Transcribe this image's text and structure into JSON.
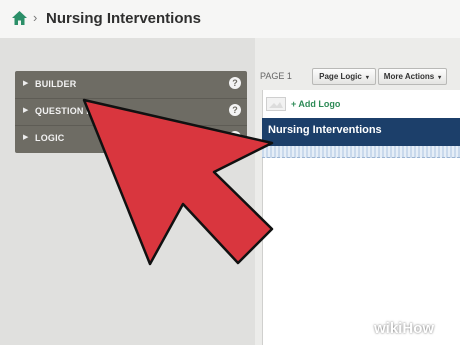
{
  "header": {
    "separator": "›",
    "title": "Nursing Interventions"
  },
  "sidebar": {
    "items": [
      {
        "label": "BUILDER",
        "help": "?"
      },
      {
        "label": "QUESTION B",
        "help": "?"
      },
      {
        "label": "LOGIC",
        "help": "?"
      }
    ]
  },
  "toolbar": {
    "page_label": "PAGE 1",
    "page_logic": "Page Logic",
    "more_actions": "More Actions",
    "caret": "▾"
  },
  "survey": {
    "add_logo": "+ Add Logo",
    "title": "Nursing Interventions"
  },
  "watermark": {
    "wiki": "wiki",
    "how": "How"
  },
  "colors": {
    "header_bg": "#1c3f6a",
    "accent_green": "#2e8b57",
    "arrow_red": "#d9363e",
    "menu_bg": "#6e6c64"
  },
  "icons": {
    "home": "home-icon",
    "arrow": "red-pointer-arrow",
    "help": "help-icon"
  }
}
